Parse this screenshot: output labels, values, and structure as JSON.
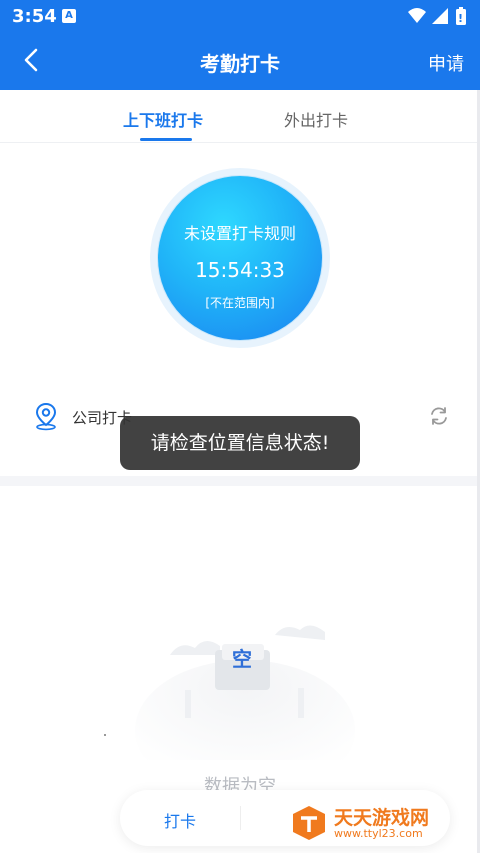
{
  "status_bar": {
    "time": "3:54",
    "notif_letter": "A"
  },
  "app_bar": {
    "title": "考勤打卡",
    "apply_label": "申请"
  },
  "tabs": [
    {
      "label": "上下班打卡",
      "active": true
    },
    {
      "label": "外出打卡",
      "active": false
    }
  ],
  "punch": {
    "rule_text": "未设置打卡规则",
    "clock": "15:54:33",
    "range_status": "[不在范围内]"
  },
  "location": {
    "label": "公司打卡"
  },
  "toast": {
    "message": "请检查位置信息状态!"
  },
  "empty_state": {
    "text": "数据为空",
    "badge": "空"
  },
  "bottom_nav": {
    "active_label": "打卡"
  },
  "watermark": {
    "name": "天天游戏网",
    "url": "www.ttyl23.com"
  },
  "colors": {
    "primary": "#1a78ec",
    "watermark": "#f07a1e"
  }
}
